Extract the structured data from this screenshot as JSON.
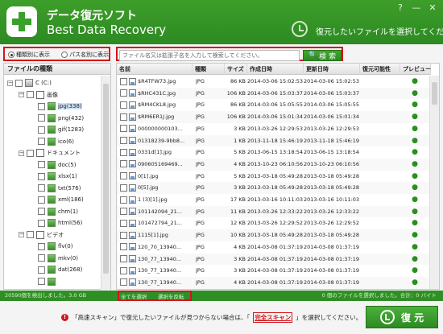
{
  "header": {
    "title_jp": "データ復元ソフト",
    "title_en": "Best Data Recovery",
    "history_hint": "復元したいファイルを選択してください",
    "window_buttons": [
      "?",
      "—",
      "✕"
    ]
  },
  "view_mode": {
    "options": [
      "種類別に表示",
      "パス名別に表示"
    ],
    "selected": "種類別に表示"
  },
  "search": {
    "placeholder": "ファイル名又は拡張子名を入力して検索してください。",
    "button": "検 索"
  },
  "left_panel": {
    "header": "ファイルの種類",
    "tree": [
      {
        "label": "C (C:)",
        "level": 0,
        "icon": "drive"
      },
      {
        "label": "画像",
        "level": 1,
        "icon": "folder"
      },
      {
        "label": "jpg(338)",
        "level": 2,
        "icon": "image",
        "selected": true
      },
      {
        "label": "png(432)",
        "level": 2,
        "icon": "image"
      },
      {
        "label": "gif(1283)",
        "level": 2,
        "icon": "image"
      },
      {
        "label": "ico(6)",
        "level": 2,
        "icon": "image"
      },
      {
        "label": "ドキュメント",
        "level": 1,
        "icon": "folder"
      },
      {
        "label": "doc(5)",
        "level": 2,
        "icon": "image"
      },
      {
        "label": "xlsx(1)",
        "level": 2,
        "icon": "image"
      },
      {
        "label": "txt(576)",
        "level": 2,
        "icon": "image"
      },
      {
        "label": "xml(186)",
        "level": 2,
        "icon": "image"
      },
      {
        "label": "chm(1)",
        "level": 2,
        "icon": "image"
      },
      {
        "label": "html(56)",
        "level": 2,
        "icon": "image"
      },
      {
        "label": "ビデオ",
        "level": 1,
        "icon": "folder"
      },
      {
        "label": "flv(0)",
        "level": 2,
        "icon": "image"
      },
      {
        "label": "mkv(0)",
        "level": 2,
        "icon": "image"
      },
      {
        "label": "dat(268)",
        "level": 2,
        "icon": "image"
      },
      {
        "label": "",
        "level": 2,
        "icon": "image"
      }
    ]
  },
  "table": {
    "columns": [
      "名前",
      "種類",
      "サイズ",
      "作成日時",
      "更新日時",
      "復元可能性",
      "プレビュー"
    ],
    "rows": [
      [
        "$R4TFW73.jpg",
        "JPG",
        "86 KB",
        "2014-03-06 15:02:53",
        "2014-03-06 15:02:53"
      ],
      [
        "$RHC431C.jpg",
        "JPG",
        "106 KB",
        "2014-03-06 15:03:37",
        "2014-03-06 15:03:37"
      ],
      [
        "$RM4CKL8.jpg",
        "JPG",
        "86 KB",
        "2014-03-06 15:05:55",
        "2014-03-06 15:05:55"
      ],
      [
        "$RM6ER1J.jpg",
        "JPG",
        "106 KB",
        "2014-03-06 15:01:34",
        "2014-03-06 15:01:34"
      ],
      [
        "000000000103...",
        "JPG",
        "3 KB",
        "2013-03-26 12:29:53",
        "2013-03-26 12:29:53"
      ],
      [
        "01318239-9bb8...",
        "JPG",
        "1 KB",
        "2013-11-18 15:46:19",
        "2013-11-18 15:46:19"
      ],
      [
        "0331d[1].jpg",
        "JPG",
        "5 KB",
        "2013-06-15 13:18:54",
        "2013-06-15 13:18:54"
      ],
      [
        "090605169469...",
        "JPG",
        "4 KB",
        "2013-10-23 06:10:56",
        "2013-10-23 06:10:56"
      ],
      [
        "0[1].jpg",
        "JPG",
        "5 KB",
        "2013-03-18 05:49:28",
        "2013-03-18 05:49:28"
      ],
      [
        "0[5].jpg",
        "JPG",
        "3 KB",
        "2013-03-18 05:49:28",
        "2013-03-18 05:49:28"
      ],
      [
        "1 (3)[1].jpg",
        "JPG",
        "17 KB",
        "2013-03-16 10:11:03",
        "2013-03-16 10:11:03"
      ],
      [
        "101142094_21...",
        "JPG",
        "11 KB",
        "2013-03-26 12:33:22",
        "2013-03-26 12:33:22"
      ],
      [
        "101472794_21...",
        "JPG",
        "12 KB",
        "2013-03-26 12:29:52",
        "2013-03-26 12:29:52"
      ],
      [
        "1115[1].jpg",
        "JPG",
        "10 KB",
        "2013-03-18 05:49:28",
        "2013-03-18 05:49:28"
      ],
      [
        "120_70_13940...",
        "JPG",
        "4 KB",
        "2014-03-08 01:37:19",
        "2014-03-08 01:37:19"
      ],
      [
        "130_77_13940...",
        "JPG",
        "3 KB",
        "2014-03-08 01:37:19",
        "2014-03-08 01:37:19"
      ],
      [
        "130_77_13940...",
        "JPG",
        "3 KB",
        "2014-03-08 01:37:19",
        "2014-03-08 01:37:19"
      ],
      [
        "130_77_13940...",
        "JPG",
        "4 KB",
        "2014-03-08 01:37:19",
        "2014-03-08 01:37:19"
      ],
      [
        "130_77_13940...",
        "JPG",
        "3 KB",
        "2014-03-08 01:37:19",
        "2014-03-08 01:37:19"
      ]
    ],
    "preview_icon": "eye-icon"
  },
  "bulk": {
    "select_all": "全てを選択",
    "invert": "選択を反転"
  },
  "status": {
    "found": "20590個を検出しました。3.0 GB",
    "selected": "0 個のファイルを選択しました。合計：0 バイト"
  },
  "footer": {
    "note_pre": "「高速スキャン」で復元したいファイルが見つからない場合は、「",
    "link": "完全スキャン",
    "note_post": "」を選択してください。",
    "recover_button": "復 元"
  },
  "colors": {
    "accent": "#2c8a22",
    "highlight_border": "#d0151b"
  }
}
